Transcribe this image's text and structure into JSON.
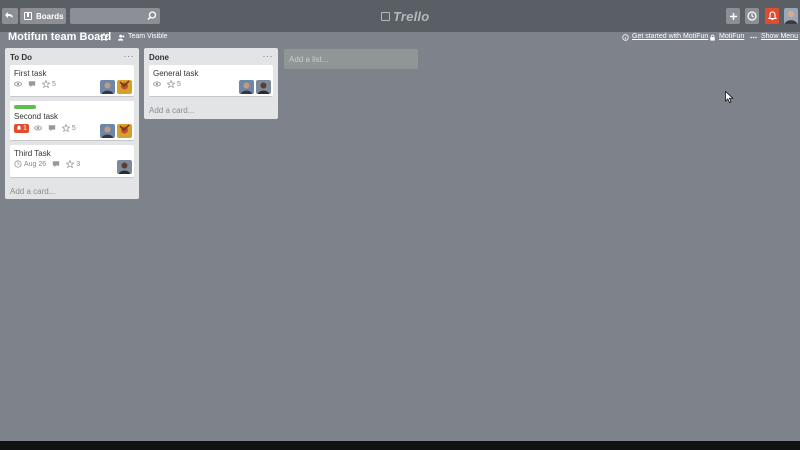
{
  "topbar": {
    "boards_label": "Boards",
    "search_value": "",
    "logo_text": "Trello"
  },
  "board": {
    "title": "Motifun team Board",
    "visibility": "Team Visible",
    "get_started": "Get started with MotiFun",
    "org": "MotiFun",
    "show_menu": "Show Menu"
  },
  "lists": [
    {
      "title": "To Do",
      "menu": "···",
      "add_card": "Add a card...",
      "cards": [
        {
          "title": "First task",
          "votes": "5"
        },
        {
          "title": "Second task",
          "label_color": "#61bd4f",
          "alert": "1",
          "votes": "5"
        },
        {
          "title": "Third Task",
          "due": "Aug 26",
          "votes": "3"
        }
      ]
    },
    {
      "title": "Done",
      "menu": "···",
      "add_card": "Add a card...",
      "cards": [
        {
          "title": "General task",
          "votes": "5"
        }
      ]
    }
  ],
  "add_list": "Add a list...",
  "colors": {
    "board_bg": "#7e838b",
    "topbar_bg": "#5a5f66",
    "notification_red": "#e04d2e",
    "label_green": "#61bd4f"
  },
  "icons": [
    "back-arrow-icon",
    "board-icon",
    "search-icon",
    "trello-logo-icon",
    "plus-icon",
    "info-icon",
    "bell-icon",
    "star-icon",
    "people-icon",
    "eye-icon",
    "comment-icon",
    "clock-icon",
    "lock-icon",
    "ellipsis-icon",
    "mouse-cursor-icon"
  ]
}
